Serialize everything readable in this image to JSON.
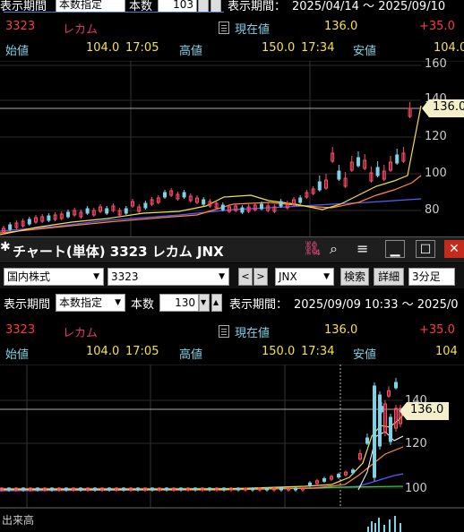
{
  "top_toolbar": {
    "period_label": "表示期間",
    "period_mode": "本数指定",
    "count_label": "本数",
    "count_value": "103",
    "range_label": "表示期間：",
    "range_value": "2025/04/14 ～ 2025/09/10"
  },
  "chart1": {
    "code": "3323",
    "name": "レカム",
    "current_label": "現在値",
    "current_value": "136.0",
    "change": "+35.0",
    "open_label": "始値",
    "open_value": "104.0",
    "open_time": "17:05",
    "high_label": "高値",
    "high_value": "150.0",
    "high_time": "17:34",
    "low_label": "安値",
    "low_value": "104.0",
    "price_badge": "136.0",
    "y_ticks": [
      "160",
      "140",
      "120",
      "100",
      "80"
    ]
  },
  "window": {
    "title": "チャート(単体) 3323 レカム JNX",
    "link_icon_count": "4"
  },
  "toolbar2": {
    "market": "国内株式",
    "code_input": "3323",
    "exchange": "JNX",
    "search_button": "検索",
    "detail_button": "詳細",
    "interval": "3分足"
  },
  "toolbar3": {
    "period_label": "表示期間",
    "period_mode": "本数指定",
    "count_label": "本数",
    "count_value": "130",
    "range_label": "表示期間：",
    "range_value": "2025/09/09 10:33 ～ 2025/0"
  },
  "chart2": {
    "code": "3323",
    "name": "レカム",
    "current_label": "現在値",
    "current_value": "136.0",
    "change": "+35.0",
    "open_label": "始値",
    "open_value": "104.0",
    "open_time": "17:05",
    "high_label": "高値",
    "high_value": "150.0",
    "high_time": "17:34",
    "low_label": "安値",
    "low_value": "104",
    "price_badge": "136.0",
    "y_ticks": [
      "140",
      "120",
      "100"
    ],
    "volume_label": "出来高"
  },
  "colors": {
    "background": "#000000",
    "candle_up": "#ff4d6a",
    "candle_down": "#7fd1e6",
    "ma_short": "#f5e04a",
    "ma_mid": "#ff8c3a",
    "ma_long": "#5a5aff",
    "ma_green": "#3fc83f"
  }
}
